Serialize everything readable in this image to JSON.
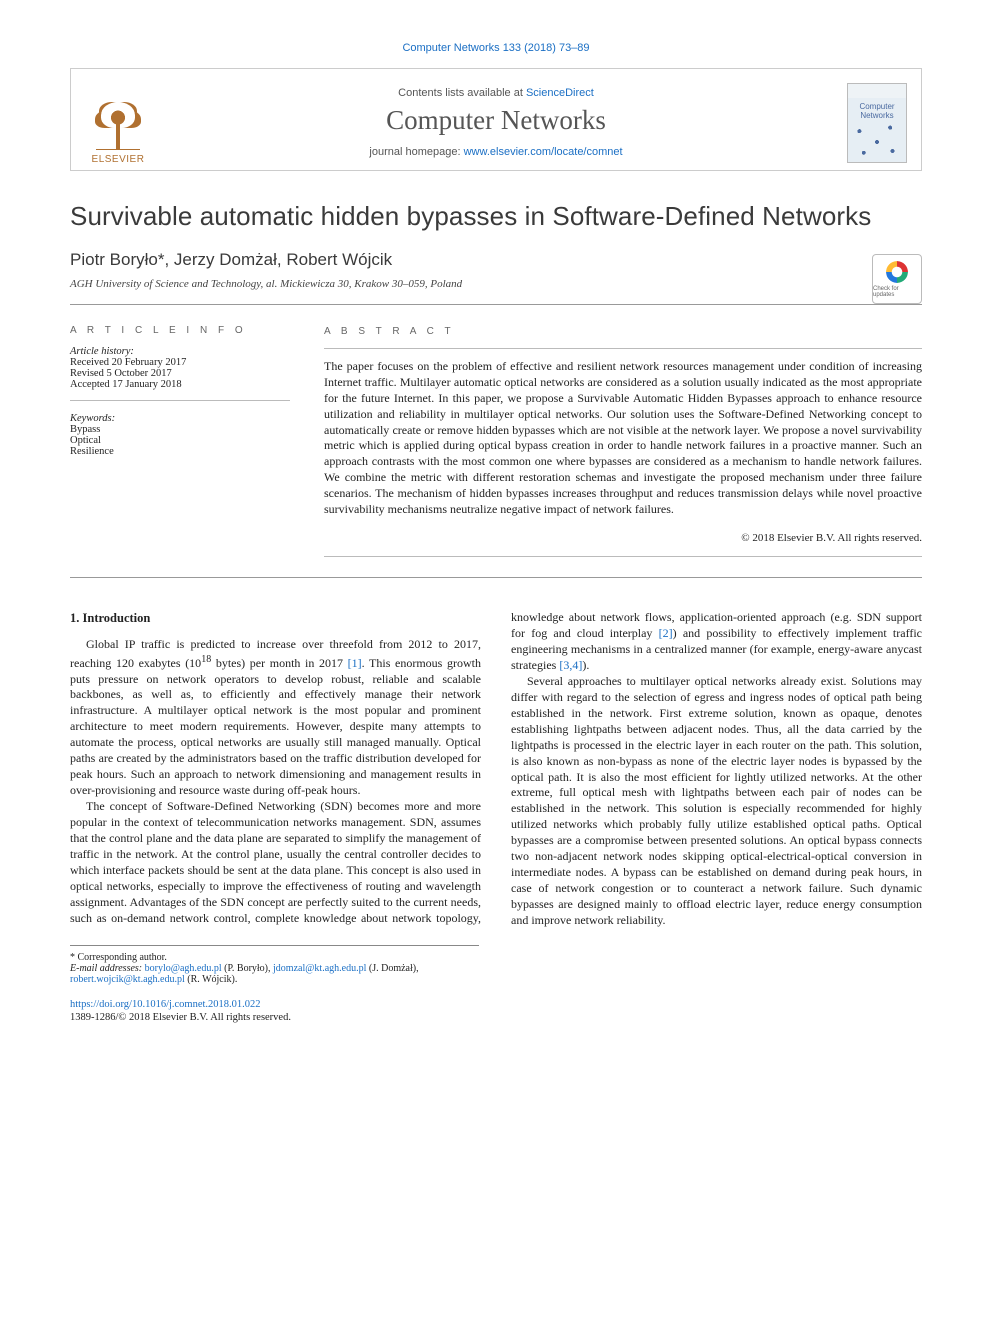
{
  "citation_header": "Computer Networks 133 (2018) 73–89",
  "header": {
    "contents_line_prefix": "Contents lists available at ",
    "contents_link": "ScienceDirect",
    "journal_name": "Computer Networks",
    "home_prefix": "journal homepage: ",
    "home_link": "www.elsevier.com/locate/comnet",
    "publisher_logo_text": "ELSEVIER",
    "cover_label_top": "Computer",
    "cover_label_bottom": "Networks"
  },
  "crossmark_label": "Check for updates",
  "title": "Survivable automatic hidden bypasses in Software-Defined Networks",
  "authors_line": "Piotr Boryło*, Jerzy Domżał, Robert Wójcik",
  "affiliation": "AGH University of Science and Technology, al. Mickiewicza 30, Krakow 30–059, Poland",
  "article_info": {
    "heading": "a r t i c l e   i n f o",
    "history_label": "Article history:",
    "received": "Received 20 February 2017",
    "revised": "Revised 5 October 2017",
    "accepted": "Accepted 17 January 2018",
    "keywords_label": "Keywords:",
    "keywords": [
      "Bypass",
      "Optical",
      "Resilience"
    ]
  },
  "abstract": {
    "heading": "a b s t r a c t",
    "text": "The paper focuses on the problem of effective and resilient network resources management under condition of increasing Internet traffic. Multilayer automatic optical networks are considered as a solution usually indicated as the most appropriate for the future Internet. In this paper, we propose a Survivable Automatic Hidden Bypasses approach to enhance resource utilization and reliability in multilayer optical networks. Our solution uses the Software-Defined Networking concept to automatically create or remove hidden bypasses which are not visible at the network layer. We propose a novel survivability metric which is applied during optical bypass creation in order to handle network failures in a proactive manner. Such an approach contrasts with the most common one where bypasses are considered as a mechanism to handle network failures. We combine the metric with different restoration schemas and investigate the proposed mechanism under three failure scenarios. The mechanism of hidden bypasses increases throughput and reduces transmission delays while novel proactive survivability mechanisms neutralize negative impact of network failures.",
    "copyright": "© 2018 Elsevier B.V. All rights reserved."
  },
  "body": {
    "section_heading": "1. Introduction",
    "p1a": "Global IP traffic is predicted to increase over threefold from 2012 to 2017, reaching 120 exabytes (10",
    "p1_exp": "18",
    "p1b": " bytes) per month in 2017 ",
    "p1_ref": "[1]",
    "p1c": ". This enormous growth puts pressure on network operators to develop robust, reliable and scalable backbones, as well as, to efficiently and effectively manage their network infrastructure. A multilayer optical network is the most popular and prominent architecture to meet modern requirements. However, despite many attempts to automate the process, optical networks are usually still managed manually. Optical paths are created by the administrators based on the traffic distribution developed for peak hours. Such an approach to network dimensioning and management results in over-provisioning and resource waste during off-peak hours.",
    "p2a": "The concept of Software-Defined Networking (SDN) becomes more and more popular in the context of telecommunication networks management. SDN, assumes that the control plane and the data plane are separated to simplify the management of traffic in the network. At the control plane, usually the central controller decides to which interface packets should be sent at the data plane. This concept is also used in optical networks, especially to improve the effectiveness of routing and wavelength assignment. Advantages of the SDN concept are perfectly suited to the cur",
    "p2b": "rent needs, such as on-demand network control, complete knowledge about network topology, knowledge about network flows, application-oriented approach (e.g. SDN support for fog and cloud interplay ",
    "p2_ref2": "[2]",
    "p2c": ") and possibility to effectively implement traffic engineering mechanisms in a centralized manner (for example, energy-aware anycast strategies ",
    "p2_ref34": "[3,4]",
    "p2d": ").",
    "p3": "Several approaches to multilayer optical networks already exist. Solutions may differ with regard to the selection of egress and ingress nodes of optical path being established in the network. First extreme solution, known as opaque, denotes establishing lightpaths between adjacent nodes. Thus, all the data carried by the lightpaths is processed in the electric layer in each router on the path. This solution, is also known as non-bypass as none of the electric layer nodes is bypassed by the optical path. It is also the most efficient for lightly utilized networks. At the other extreme, full optical mesh with lightpaths between each pair of nodes can be established in the network. This solution is especially recommended for highly utilized networks which probably fully utilize established optical paths. Optical bypasses are a compromise between presented solutions. An optical bypass connects two non-adjacent network nodes skipping optical-electrical-optical conversion in intermediate nodes. A bypass can be established on demand during peak hours, in case of network congestion or to counteract a network failure. Such dynamic bypasses are designed mainly to offload electric layer, reduce energy consumption and improve network reliability."
  },
  "footnotes": {
    "corr": "* Corresponding author.",
    "email_label": "E-mail addresses:",
    "emails": [
      {
        "addr": "borylo@agh.edu.pl",
        "who": "(P. Boryło),"
      },
      {
        "addr": "jdomzal@kt.agh.edu.pl",
        "who": "(J. Domżał),"
      },
      {
        "addr": "robert.wojcik@kt.agh.edu.pl",
        "who": "(R. Wójcik)."
      }
    ]
  },
  "bottom": {
    "doi": "https://doi.org/10.1016/j.comnet.2018.01.022",
    "issn_line": "1389-1286/© 2018 Elsevier B.V. All rights reserved."
  }
}
